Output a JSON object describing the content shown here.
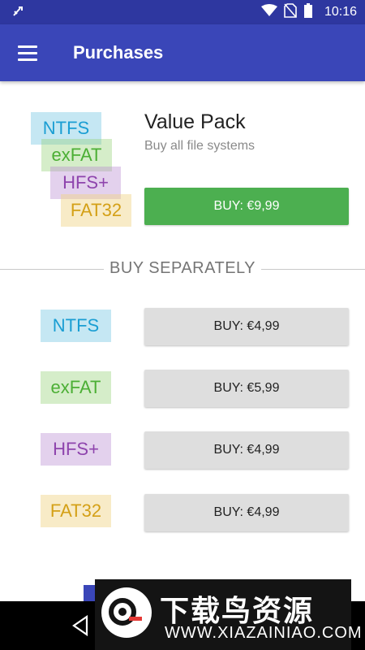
{
  "status_bar": {
    "time": "10:16",
    "icons": [
      "data-saver-icon",
      "wifi-icon",
      "no-sim-icon",
      "battery-icon"
    ]
  },
  "app_bar": {
    "title": "Purchases",
    "menu_icon": "hamburger-menu-icon"
  },
  "value_pack": {
    "title": "Value Pack",
    "subtitle": "Buy all file systems",
    "tags": [
      "NTFS",
      "exFAT",
      "HFS+",
      "FAT32"
    ],
    "buy_label": "BUY: €9,99"
  },
  "separator_label": "BUY SEPARATELY",
  "items": [
    {
      "name": "NTFS",
      "buy_label": "BUY: €4,99"
    },
    {
      "name": "exFAT",
      "buy_label": "BUY: €5,99"
    },
    {
      "name": "HFS+",
      "buy_label": "BUY: €4,99"
    },
    {
      "name": "FAT32",
      "buy_label": "BUY: €4,99"
    }
  ],
  "watermark": {
    "title": "下载鸟资源",
    "url": "WWW.XIAZAINIAO.COM"
  },
  "colors": {
    "status_bar": "#2e37a0",
    "app_bar": "#3a46b8",
    "buy_green": "#4caf50",
    "buy_gray": "#dedede",
    "ntfs": "#1a9ed3",
    "exfat": "#4caf35",
    "hfs": "#8e44ad",
    "fat32": "#d4a017"
  }
}
